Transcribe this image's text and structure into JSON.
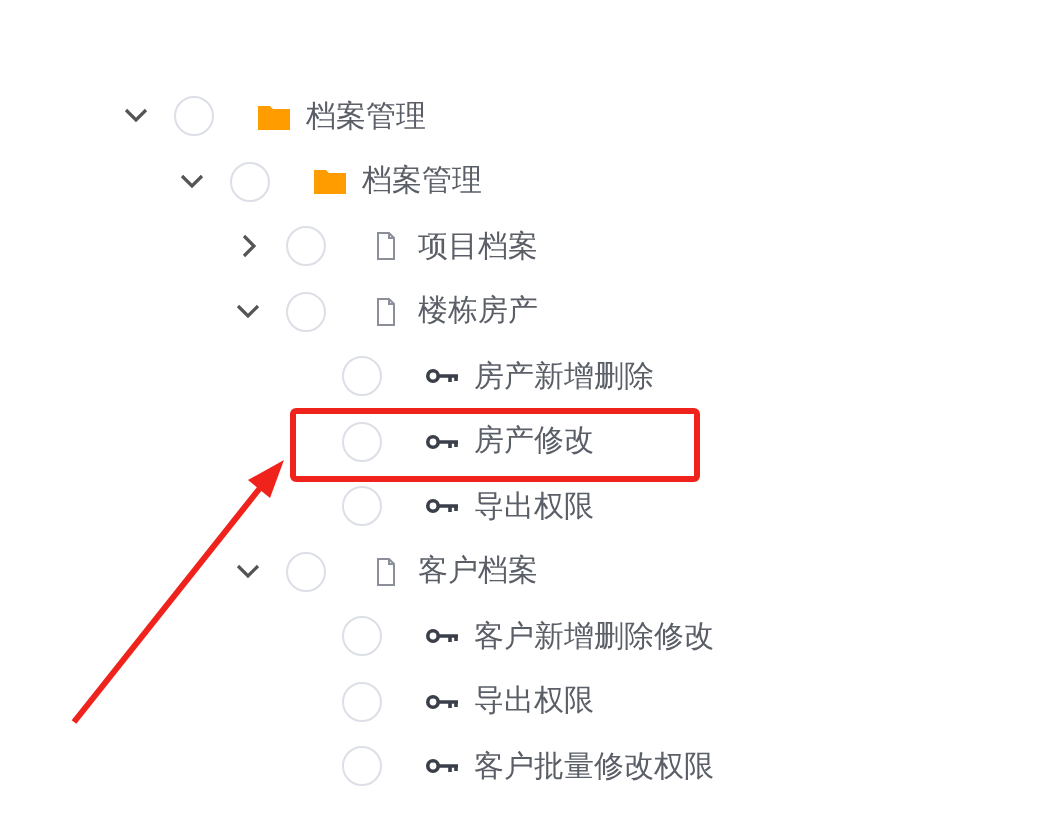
{
  "tree": [
    {
      "label": "档案管理",
      "kind": "folder",
      "checked": false,
      "expanded": true,
      "children": [
        {
          "label": "档案管理",
          "kind": "folder",
          "checked": false,
          "expanded": true,
          "children": [
            {
              "label": "项目档案",
              "kind": "file",
              "checked": false,
              "expanded": false
            },
            {
              "label": "楼栋房产",
              "kind": "file",
              "checked": false,
              "expanded": true,
              "children": [
                {
                  "label": "房产新增删除",
                  "kind": "permission",
                  "checked": false
                },
                {
                  "label": "房产修改",
                  "kind": "permission",
                  "checked": false,
                  "highlighted": true
                },
                {
                  "label": "导出权限",
                  "kind": "permission",
                  "checked": false
                }
              ]
            },
            {
              "label": "客户档案",
              "kind": "file",
              "checked": false,
              "expanded": true,
              "children": [
                {
                  "label": "客户新增删除修改",
                  "kind": "permission",
                  "checked": false
                },
                {
                  "label": "导出权限",
                  "kind": "permission",
                  "checked": false
                },
                {
                  "label": "客户批量修改权限",
                  "kind": "permission",
                  "checked": false
                }
              ]
            }
          ]
        }
      ]
    }
  ]
}
